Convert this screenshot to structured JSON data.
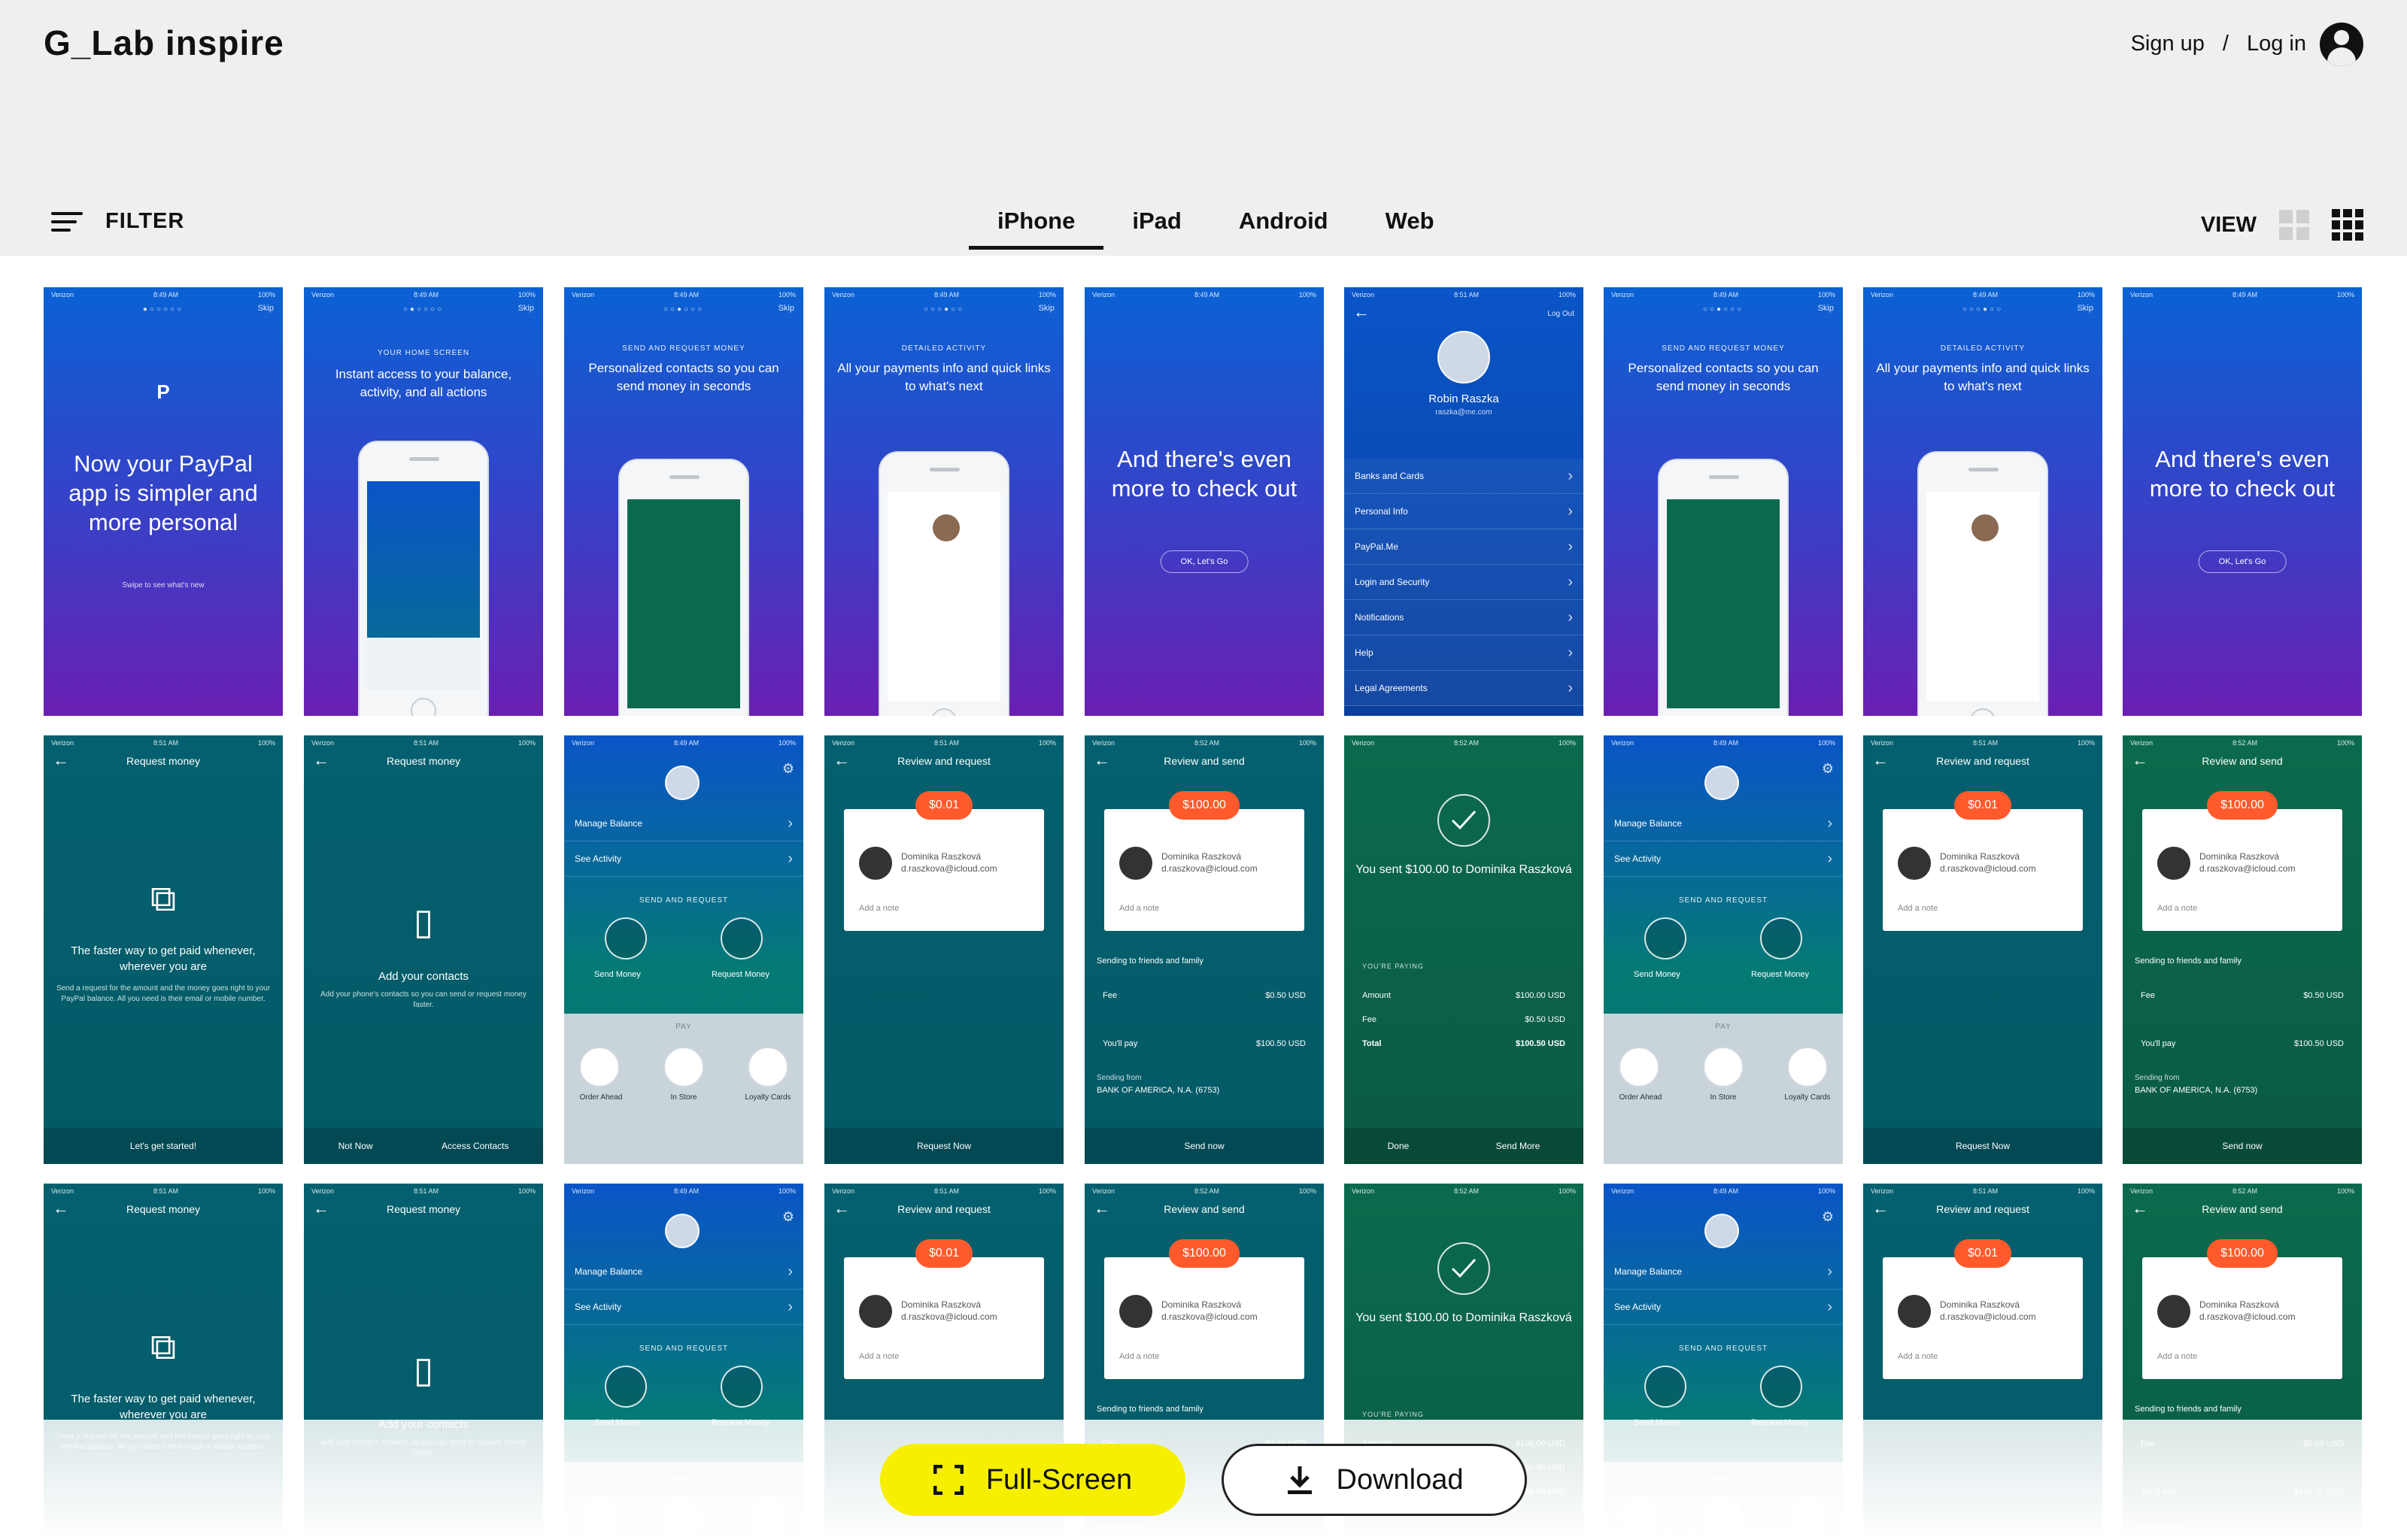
{
  "brand": {
    "name": "G_Lab inspire"
  },
  "auth": {
    "signup": "Sign up",
    "sep": "/",
    "login": "Log in"
  },
  "filter": {
    "label": "FILTER"
  },
  "tabs": [
    {
      "label": "iPhone",
      "active": true
    },
    {
      "label": "iPad"
    },
    {
      "label": "Android"
    },
    {
      "label": "Web"
    }
  ],
  "view": {
    "label": "VIEW"
  },
  "actions": {
    "fullscreen": "Full-Screen",
    "download": "Download"
  },
  "status": {
    "carrier": "Verizon",
    "time1": "8:49 AM",
    "time2": "8:51 AM",
    "time3": "8:52 AM"
  },
  "screens": {
    "skip": "Skip",
    "welcome_title": "Now your PayPal app is simpler and more personal",
    "welcome_sub": "Swipe to see what's new",
    "home_caps": "YOUR HOME SCREEN",
    "home_title": "Instant access to your balance, activity, and all actions",
    "send_caps": "SEND AND REQUEST MONEY",
    "send_title": "Personalized contacts so you can send money in seconds",
    "activity_caps": "DETAILED ACTIVITY",
    "activity_title": "All your payments info and quick links to what's next",
    "more_title": "And there's even more to check out",
    "more_btn": "OK, Let's Go",
    "profile_name": "Robin Raszka",
    "profile_email": "raszka@me.com",
    "logout": "Log Out",
    "menu": [
      "Banks and Cards",
      "Personal Info",
      "PayPal.Me",
      "Login and Security",
      "Notifications",
      "Help",
      "Legal Agreements"
    ],
    "request_head": "Request money",
    "request_title": "The faster way to get paid whenever, wherever you are",
    "request_sub": "Send a request for the amount and the money goes right to your PayPal balance. All you need is their email or mobile number.",
    "request_btn": "Let's get started!",
    "contacts_title": "Add your contacts",
    "contacts_sub": "Add your phone's contacts so you can send or request money faster.",
    "not_now": "Not Now",
    "access": "Access Contacts",
    "manage": "Manage Balance",
    "see_activity": "See Activity",
    "send_request": "SEND AND REQUEST",
    "send_money": "Send Money",
    "request_money": "Request Money",
    "pay": "PAY",
    "order_ahead": "Order Ahead",
    "in_store": "In Store",
    "loyalty": "Loyalty Cards",
    "review_request": "Review and request",
    "review_send": "Review and send",
    "amount_small": "$0.01",
    "amount_big": "$100.00",
    "contact_name": "Dominika Raszková",
    "contact_email": "d.raszkova@icloud.com",
    "add_note": "Add a note",
    "request_now": "Request Now",
    "send_now": "Send now",
    "friends": "Sending to friends and family",
    "fee": "Fee",
    "fee_val": "$0.50 USD",
    "youll_pay": "You'll pay",
    "youll_pay_val": "$100.50 USD",
    "sending_from": "Sending from",
    "bank": "BANK OF AMERICA, N.A. (6753)",
    "sent_title": "You sent $100.00 to Dominika Raszková",
    "youre_paying": "YOU'RE PAYING",
    "amount": "Amount",
    "amount_val": "$100.00 USD",
    "total": "Total",
    "total_val": "$100.50 USD",
    "done": "Done",
    "send_more": "Send More"
  },
  "colors": {
    "accent_yellow": "#f6ef00",
    "paypal_blue": "#0a62d4",
    "purple": "#6a1fb2",
    "teal": "#04606e",
    "green": "#0b6a4d",
    "orange": "#ff5a2c"
  }
}
